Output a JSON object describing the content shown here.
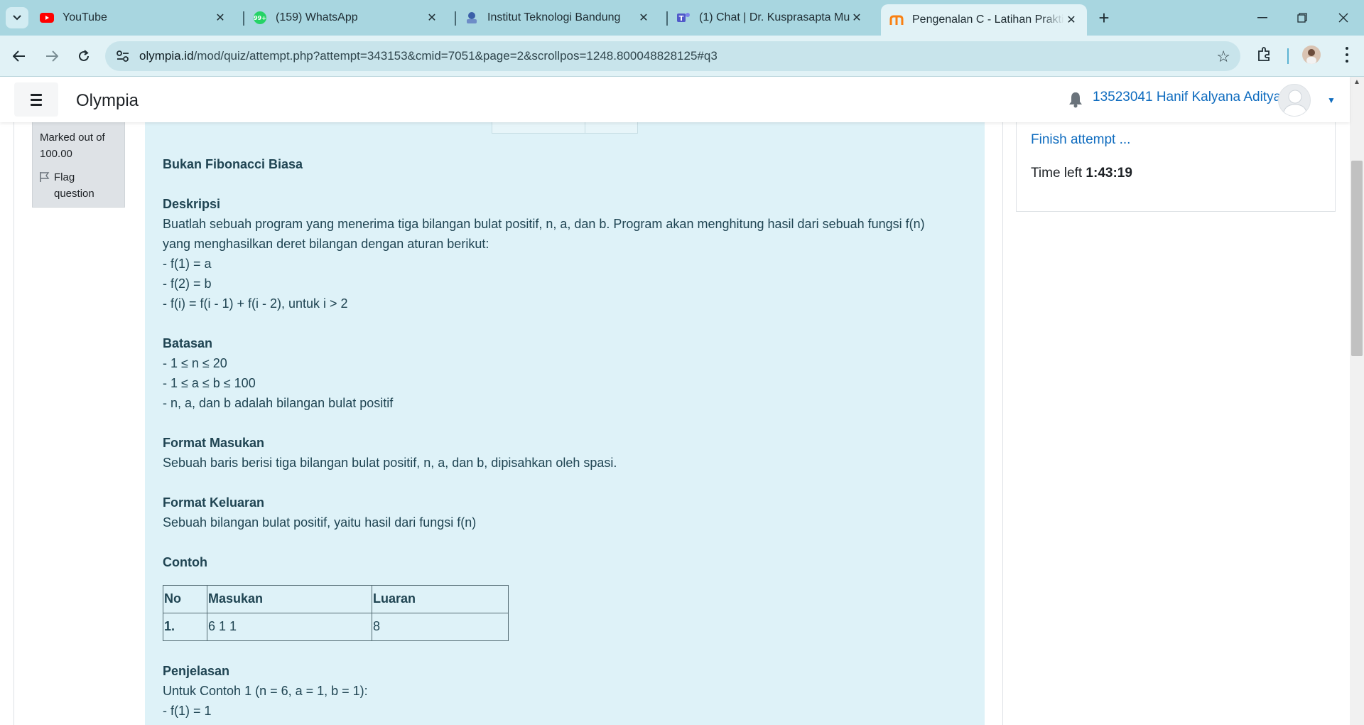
{
  "browser": {
    "tabs": [
      {
        "title": "YouTube",
        "icon": "youtube-icon",
        "color": "#ff0000"
      },
      {
        "title": "(159) WhatsApp",
        "icon": "whatsapp-icon",
        "color": "#25d366",
        "badge": "99+"
      },
      {
        "title": "Institut Teknologi Bandung",
        "icon": "itb-icon",
        "color": "#3a5fa8"
      },
      {
        "title": "(1) Chat | Dr. Kusprasapta Mutijarsa",
        "icon": "teams-icon",
        "color": "#5059c9"
      },
      {
        "title": "Pengenalan C - Latihan Praktikum",
        "icon": "moodle-icon",
        "color": "#f98012"
      }
    ],
    "active_tab_index": 4,
    "address": {
      "host": "olympia.id",
      "path": "/mod/quiz/attempt.php?attempt=343153&cmid=7051&page=2&scrollpos=1248.800048828125#q3"
    }
  },
  "navbar": {
    "site_name": "Olympia",
    "user_name": "13523041 Hanif Kalyana Aditya"
  },
  "info": {
    "marked_out_of": "Marked out of",
    "marks": "100.00",
    "flag_label": "Flag",
    "flag_label_2": "question"
  },
  "question": {
    "title": "Bukan Fibonacci Biasa",
    "deskripsi_heading": "Deskripsi",
    "deskripsi_1": "Buatlah sebuah program yang menerima tiga bilangan bulat positif, n, a, dan b. Program akan menghitung hasil dari sebuah fungsi f(n)",
    "deskripsi_2": "yang menghasilkan deret bilangan dengan aturan berikut:",
    "rules": [
      "- f(1) = a",
      "- f(2) = b",
      "- f(i) = f(i - 1) + f(i - 2), untuk i > 2"
    ],
    "batasan_heading": "Batasan",
    "batasan": [
      "- 1 ≤ n ≤ 20",
      "- 1 ≤ a ≤ b ≤ 100",
      "- n, a, dan b adalah bilangan bulat positif"
    ],
    "masukan_heading": "Format Masukan",
    "masukan": "Sebuah baris berisi tiga bilangan bulat positif, n, a, dan b, dipisahkan oleh spasi.",
    "keluaran_heading": "Format Keluaran",
    "keluaran": "Sebuah bilangan bulat positif, yaitu hasil dari fungsi f(n)",
    "contoh_heading": "Contoh",
    "table": {
      "headers": [
        "No",
        "Masukan",
        "Luaran"
      ],
      "rows": [
        [
          "1.",
          "6 1 1",
          "8"
        ]
      ]
    },
    "penjelasan_heading": "Penjelasan",
    "penjelasan_1": "Untuk Contoh 1 (n = 6, a = 1, b = 1):",
    "penjelasan_2": "- f(1) = 1"
  },
  "quiz_nav": {
    "finish_label": "Finish attempt ...",
    "time_left_label": "Time left",
    "time_left_value": "1:43:19"
  }
}
